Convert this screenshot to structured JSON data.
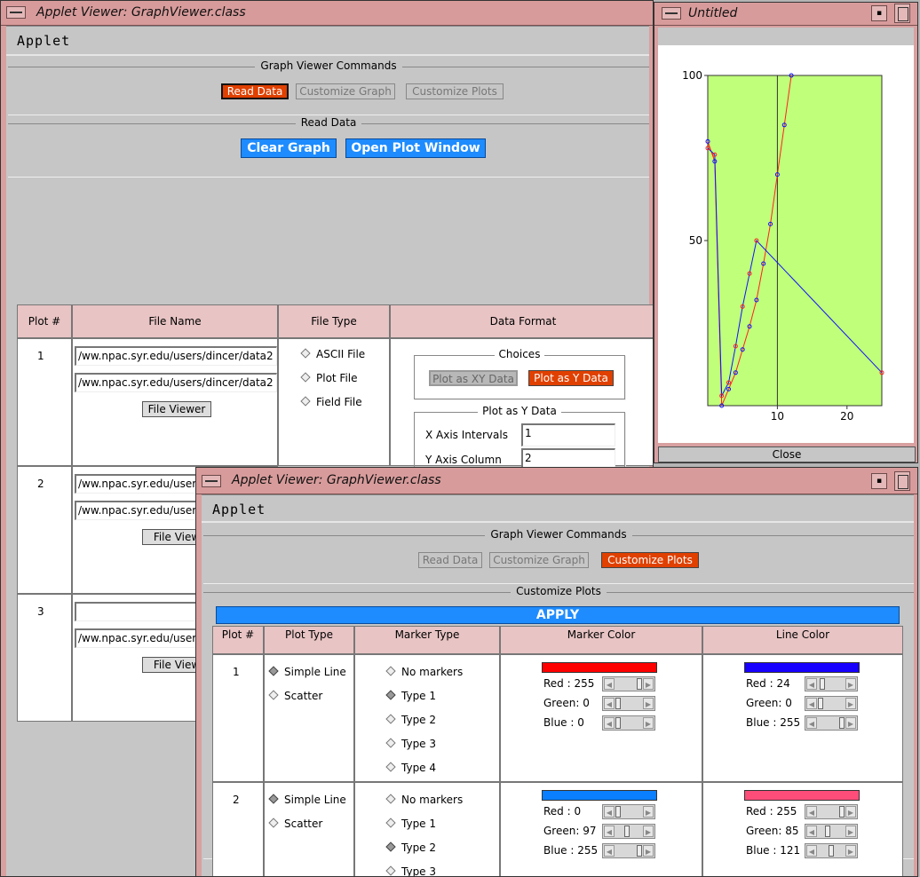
{
  "main_window": {
    "title": "Applet Viewer: GraphViewer.class",
    "applet_label": "Applet",
    "commands_label": "Graph Viewer Commands",
    "cmd_buttons": [
      "Read Data",
      "Customize Graph",
      "Customize Plots"
    ],
    "read_data_label": "Read Data",
    "clear_graph": "Clear Graph",
    "open_plot_window": "Open Plot Window",
    "table_headers": [
      "Plot #",
      "File Name",
      "File Type",
      "Data Format"
    ],
    "rows": [
      {
        "num": "1",
        "file1": "/ww.npac.syr.edu/users/dincer/data2",
        "file2": "/ww.npac.syr.edu/users/dincer/data2",
        "viewer": "File Viewer"
      },
      {
        "num": "2",
        "file1": "/ww.npac.syr.edu/user",
        "file2": "/ww.npac.syr.edu/user",
        "viewer": "File View"
      },
      {
        "num": "3",
        "file1": "",
        "file2": "/ww.npac.syr.edu/user",
        "viewer": "File View"
      }
    ],
    "file_types": [
      "ASCII File",
      "Plot  File",
      "Field File"
    ],
    "choices_label": "Choices",
    "plot_xy": "Plot as XY Data",
    "plot_y": "Plot as Y Data",
    "plot_y_group": "Plot as Y Data",
    "x_axis_label": "X Axis Intervals",
    "x_axis_value": "1",
    "y_axis_label": "Y Axis Column",
    "y_axis_value": "2"
  },
  "plot_window": {
    "title": "Untitled",
    "close": "Close",
    "chart_data": {
      "type": "line",
      "y_ticks": [
        "100",
        "50"
      ],
      "x_ticks": [
        "10",
        "20"
      ],
      "xlim": [
        0,
        25
      ],
      "ylim": [
        0,
        100
      ],
      "series": [
        {
          "color": "#ff2020",
          "points": [
            [
              0,
              80
            ],
            [
              1,
              74
            ],
            [
              2,
              0
            ],
            [
              3,
              5
            ],
            [
              4,
              10
            ],
            [
              5,
              17
            ],
            [
              6,
              24
            ],
            [
              7,
              32
            ],
            [
              8,
              43
            ],
            [
              9,
              55
            ],
            [
              10,
              70
            ],
            [
              11,
              85
            ],
            [
              12,
              100
            ]
          ]
        },
        {
          "color": "#1010ff",
          "points": [
            [
              0,
              78
            ],
            [
              1,
              76
            ],
            [
              2,
              3
            ],
            [
              3,
              7
            ],
            [
              4,
              18
            ],
            [
              5,
              30
            ],
            [
              6,
              40
            ],
            [
              7,
              50
            ],
            [
              25,
              10
            ]
          ]
        }
      ]
    }
  },
  "second_window": {
    "title": "Applet Viewer: GraphViewer.class",
    "applet_label": "Applet",
    "commands_label": "Graph Viewer Commands",
    "cmd_buttons": [
      "Read Data",
      "Customize Graph",
      "Customize Plots"
    ],
    "customize_label": "Customize Plots",
    "apply": "APPLY",
    "table_headers": [
      "Plot #",
      "Plot Type",
      "Marker Type",
      "Marker Color",
      "Line Color"
    ],
    "plot_types": [
      "Simple Line",
      "Scatter"
    ],
    "marker_types": [
      "No markers",
      "Type 1",
      "Type 2",
      "Type 3",
      "Type 4"
    ],
    "rows": [
      {
        "num": "1",
        "marker_color": {
          "hex": "#ff0000",
          "red": "Red  : 255",
          "green": "Green: 0",
          "blue": "Blue : 0"
        },
        "line_color": {
          "hex": "#1800ff",
          "red": "Red  : 24",
          "green": "Green: 0",
          "blue": "Blue : 255"
        }
      },
      {
        "num": "2",
        "marker_color": {
          "hex": "#0061ff",
          "red": "Red  : 0",
          "green": "Green: 97",
          "blue": "Blue : 255"
        },
        "line_color": {
          "hex": "#ff5579",
          "red": "Red  : 255",
          "green": "Green: 85",
          "blue": "Blue : 121"
        }
      }
    ]
  }
}
